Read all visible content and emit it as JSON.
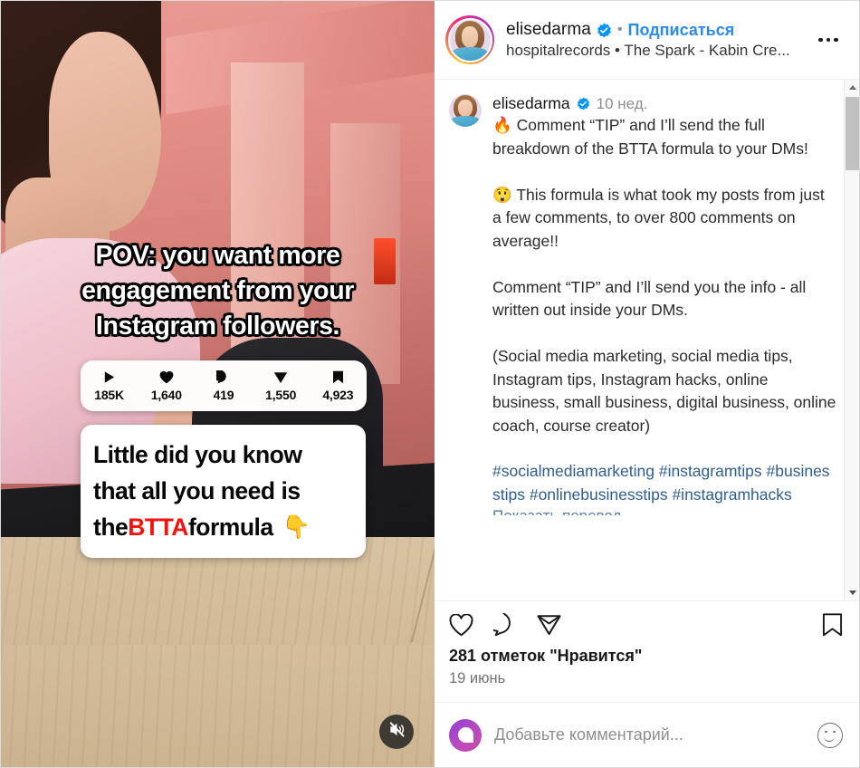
{
  "header": {
    "username": "elisedarma",
    "verified_icon": "verified-badge-icon",
    "separator": "•",
    "follow_label": "Подписаться",
    "audio_line": "hospitalrecords • The Spark - Kabin Cre...",
    "more_icon": "more-options-icon"
  },
  "caption": {
    "username": "elisedarma",
    "timestamp": "10 нед.",
    "body": "🔥 Comment “TIP” and I’ll send the full breakdown of the BTTA formula to your DMs!\n\n😲 This formula is what took my posts from just a few comments, to over 800 comments on average!!\n\nComment “TIP” and I’ll send you the info - all written out inside your DMs.\n\n(Social media marketing, social media tips, Instagram tips, Instagram hacks, online business, small business, digital business, online coach, course creator)",
    "hashtags": "#socialmediamarketing #instagramtips #businesstips #onlinebusinesstips #instagramhacks",
    "clipped_line": "Показать перевод"
  },
  "actions": {
    "like_icon": "heart-icon",
    "comment_icon": "comment-bubble-icon",
    "share_icon": "share-paper-plane-icon",
    "save_icon": "bookmark-icon",
    "likes_count": "281 отметок \"Нравится\"",
    "date": "19 июнь"
  },
  "comment_bar": {
    "avatar_icon": "user-avatar-icon",
    "placeholder": "Добавьте комментарий...",
    "emoji_icon": "emoji-smiley-icon"
  },
  "video": {
    "overlay_line1": "POV: you want more",
    "overlay_line2": "engagement from your",
    "overlay_line3": "Instagram followers.",
    "box_line1": "Little did you know",
    "box_line2": "that all you need is",
    "box_line3_pre": "the ",
    "box_line3_highlight": "BTTA",
    "box_line3_post": " formula",
    "box_line3_emoji": "👇",
    "mute_icon": "muted-speaker-icon",
    "stats": [
      {
        "icon": "play-icon",
        "value": "185K"
      },
      {
        "icon": "heart-filled-icon",
        "value": "1,640"
      },
      {
        "icon": "comment-filled-icon",
        "value": "419"
      },
      {
        "icon": "share-filled-icon",
        "value": "1,550"
      },
      {
        "icon": "bookmark-filled-icon",
        "value": "4,923"
      }
    ]
  },
  "colors": {
    "link_blue": "#2a8bef",
    "hashtag_blue": "#2d5e8e",
    "highlight_red": "#f4120a",
    "verified_blue": "#0095f6"
  }
}
